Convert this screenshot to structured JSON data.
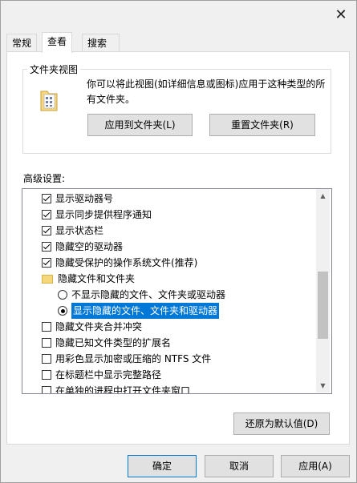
{
  "window": {
    "close_glyph": "✕"
  },
  "tabs": [
    {
      "label": "常规",
      "active": false
    },
    {
      "label": "查看",
      "active": true
    },
    {
      "label": "搜索",
      "active": false
    }
  ],
  "folder_views": {
    "title": "文件夹视图",
    "icon": "folder-icon",
    "description": "你可以将此视图(如详细信息或图标)应用于这种类型的所有文件夹。",
    "apply_button": "应用到文件夹(L)",
    "reset_button": "重置文件夹(R)"
  },
  "advanced": {
    "label": "高级设置:",
    "items": [
      {
        "type": "checkbox",
        "checked": true,
        "label": "显示驱动器号"
      },
      {
        "type": "checkbox",
        "checked": true,
        "label": "显示同步提供程序通知"
      },
      {
        "type": "checkbox",
        "checked": true,
        "label": "显示状态栏"
      },
      {
        "type": "checkbox",
        "checked": true,
        "label": "隐藏空的驱动器"
      },
      {
        "type": "checkbox",
        "checked": true,
        "label": "隐藏受保护的操作系统文件(推荐)"
      },
      {
        "type": "folder",
        "label": "隐藏文件和文件夹"
      },
      {
        "type": "radio",
        "checked": false,
        "label": "不显示隐藏的文件、文件夹或驱动器"
      },
      {
        "type": "radio",
        "checked": true,
        "selected": true,
        "label": "显示隐藏的文件、文件夹和驱动器"
      },
      {
        "type": "checkbox",
        "checked": false,
        "label": "隐藏文件夹合并冲突"
      },
      {
        "type": "checkbox",
        "checked": false,
        "label": "隐藏已知文件类型的扩展名"
      },
      {
        "type": "checkbox",
        "checked": false,
        "label": "用彩色显示加密或压缩的 NTFS 文件"
      },
      {
        "type": "checkbox",
        "checked": false,
        "label": "在标题栏中显示完整路径"
      },
      {
        "type": "checkbox",
        "checked": false,
        "label": "在单独的进程中打开文件夹窗口"
      }
    ],
    "restore_button": "还原为默认值(D)"
  },
  "footer": {
    "ok": "确定",
    "cancel": "取消",
    "apply": "应用(A)"
  },
  "colors": {
    "selection": "#0078d7",
    "dialog_bg": "#f0f0f0",
    "panel_bg": "#ffffff"
  }
}
